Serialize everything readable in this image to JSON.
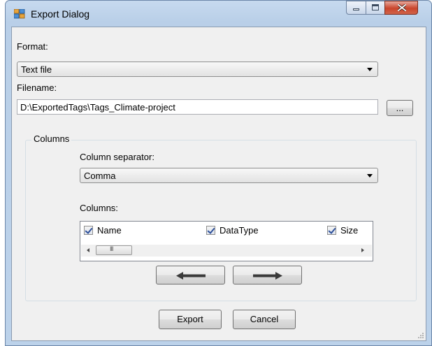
{
  "window": {
    "title": "Export Dialog"
  },
  "format": {
    "label": "Format:",
    "selected": "Text file"
  },
  "filename": {
    "label": "Filename:",
    "value": "D:\\ExportedTags\\Tags_Climate-project",
    "browse_label": "..."
  },
  "columns_group": {
    "title": "Columns",
    "separator_label": "Column separator:",
    "separator_selected": "Comma",
    "list_label": "Columns:",
    "items": [
      {
        "label": "Name",
        "checked": true
      },
      {
        "label": "DataType",
        "checked": true
      },
      {
        "label": "Size",
        "checked": true
      }
    ],
    "scroll_grip": "III"
  },
  "buttons": {
    "export": "Export",
    "cancel": "Cancel"
  },
  "icons": {
    "app": "app-window-icon",
    "minimize": "minimize-icon",
    "maximize": "maximize-icon",
    "close": "close-icon",
    "move_left": "arrow-left-icon",
    "move_right": "arrow-right-icon"
  },
  "colors": {
    "title_bar": "#c7daef",
    "close_button": "#c9452c",
    "client_bg": "#f0f0f0"
  }
}
